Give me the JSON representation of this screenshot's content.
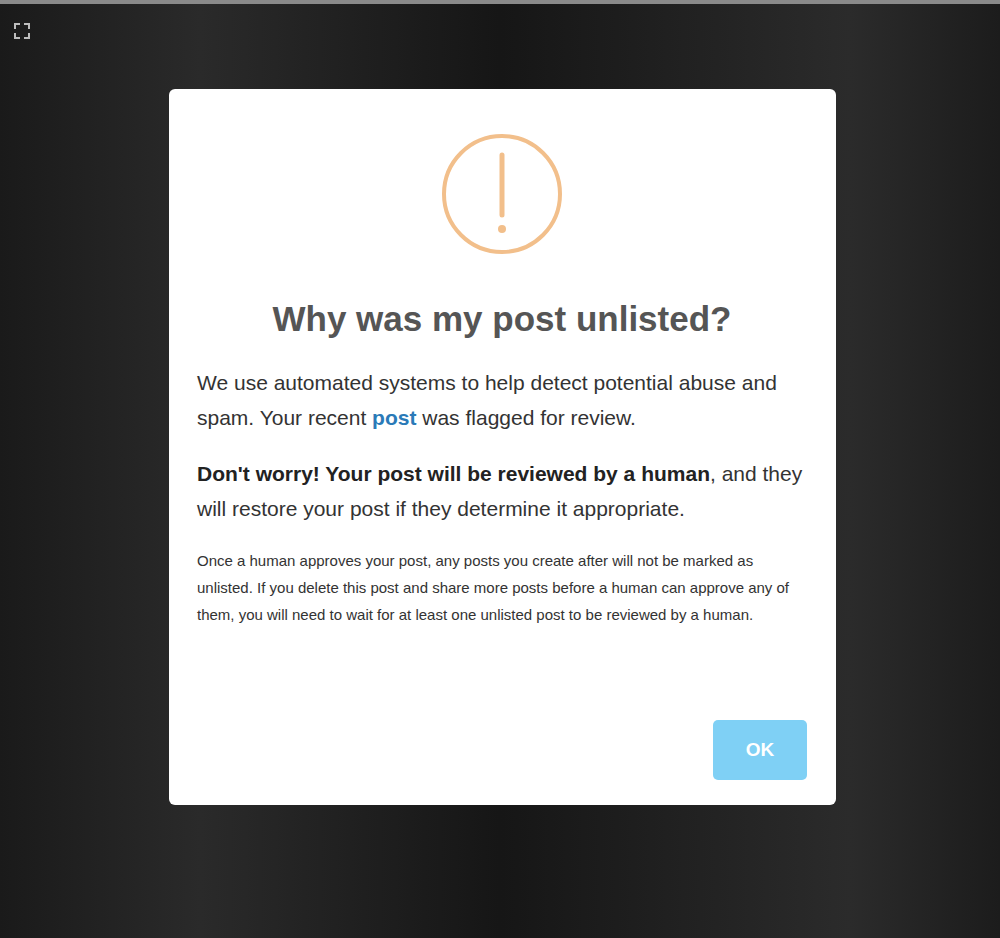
{
  "dialog": {
    "title": "Why was my post unlisted?",
    "intro": {
      "before": "We use automated systems to help detect potential abuse and spam. Your recent ",
      "link": "post",
      "after": " was flagged for review."
    },
    "reassurance": {
      "bold": "Don't worry! Your post will be reviewed by a human",
      "rest": ", and they will restore your post if they determine it appropriate."
    },
    "note": "Once a human approves your post, any posts you create after will not be marked as unlisted. If you delete this post and share more posts before a human can approve any of them, you will need to wait for at least one unlisted post to be reviewed by a human."
  },
  "buttons": [
    "OK"
  ]
}
